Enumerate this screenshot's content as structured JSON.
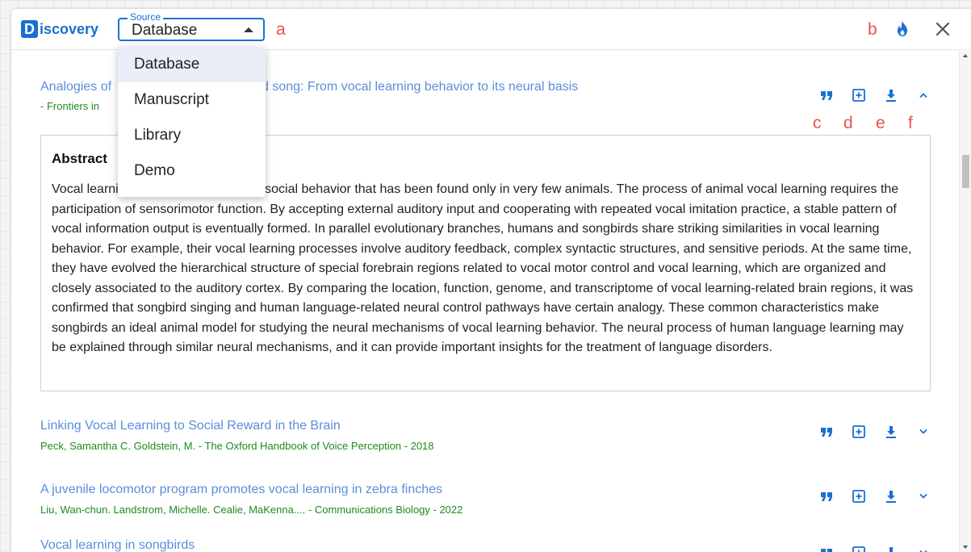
{
  "header": {
    "logo_letter": "D",
    "logo_text": "iscovery",
    "source_legend": "Source",
    "source_value": "Database",
    "annotations": {
      "a": "a",
      "b": "b"
    }
  },
  "dropdown": {
    "options": [
      "Database",
      "Manuscript",
      "Library",
      "Demo"
    ],
    "selected": "Database"
  },
  "action_annotations": {
    "c": "c",
    "d": "d",
    "e": "e",
    "f": "f"
  },
  "results": [
    {
      "title_visible_start": "Analogies of",
      "title_visible_end": "d song: From vocal learning behavior to its neural basis",
      "meta_visible": "- Frontiers in",
      "expanded": true,
      "abstract_heading": "Abstract",
      "abstract_text": "Vocal learning is a complex acquired social behavior that has been found only in very few animals. The process of animal vocal learning requires the participation of sensorimotor function. By accepting external auditory input and cooperating with repeated vocal imitation practice, a stable pattern of vocal information output is eventually formed. In parallel evolutionary branches, humans and songbirds share striking similarities in vocal learning behavior. For example, their vocal learning processes involve auditory feedback, complex syntactic structures, and sensitive periods. At the same time, they have evolved the hierarchical structure of special forebrain regions related to vocal motor control and vocal learning, which are organized and closely associated to the auditory cortex. By comparing the location, function, genome, and transcriptome of vocal learning-related brain regions, it was confirmed that songbird singing and human language-related neural control pathways have certain analogy. These common characteristics make songbirds an ideal animal model for studying the neural mechanisms of vocal learning behavior. The neural process of human language learning may be explained through similar neural mechanisms, and it can provide important insights for the treatment of language disorders."
    },
    {
      "title": "Linking Vocal Learning to Social Reward in the Brain",
      "meta": "Peck, Samantha C. Goldstein, M. - The Oxford Handbook of Voice Perception - 2018",
      "expanded": false
    },
    {
      "title": "A juvenile locomotor program promotes vocal learning in zebra finches",
      "meta": "Liu, Wan-chun. Landstrom, Michelle. Cealie, MaKenna.... - Communications Biology - 2022",
      "expanded": false
    },
    {
      "title": "Vocal learning in songbirds",
      "expanded": false
    }
  ],
  "icons": [
    "quote-icon",
    "add-box-icon",
    "download-icon",
    "chevron-up-icon",
    "chevron-down-icon",
    "flame-icon",
    "close-icon"
  ],
  "colors": {
    "brand_blue": "#1b6fd1",
    "link_blue": "#5b8ddb",
    "meta_green": "#1f8a1f",
    "annotation_red": "#e8534f"
  }
}
